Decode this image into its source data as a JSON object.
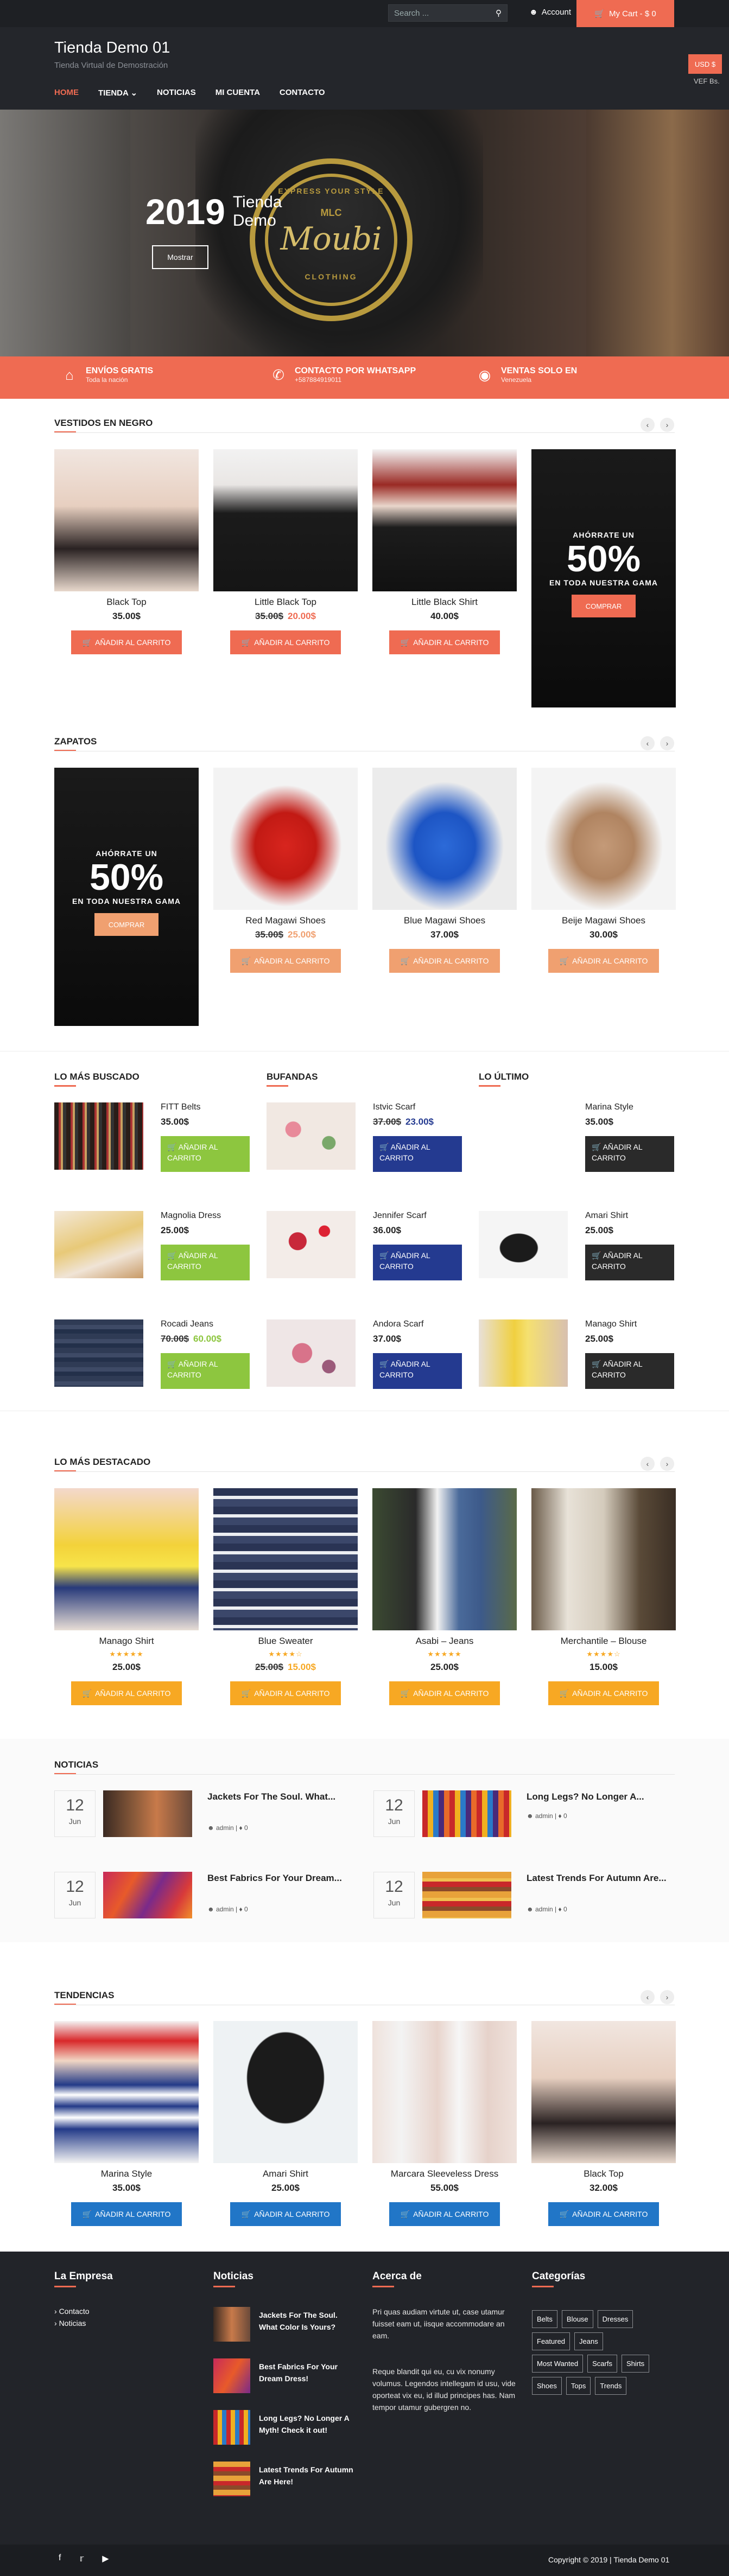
{
  "topbar": {
    "search_placeholder": "Search ...",
    "account": "Account",
    "cart": "My Cart - $ 0"
  },
  "site": {
    "title": "Tienda Demo 01",
    "tagline": "Tienda Virtual de Demostración"
  },
  "currency": {
    "btn": "USD $",
    "alt": "VEF Bs."
  },
  "nav": [
    "HOME",
    "TIENDA",
    "NOTICIAS",
    "MI CUENTA",
    "CONTACTO"
  ],
  "hero": {
    "year": "2019",
    "name_line1": "Tienda",
    "name_line2": "Demo",
    "button": "Mostrar",
    "logo_top": "EXPRESS YOUR STYLE",
    "logo_mid": "MLC",
    "logo_script": "Moubi",
    "logo_bottom": "CLOTHING"
  },
  "features": [
    {
      "icon": "store-icon",
      "title": "ENVÍOS GRATIS",
      "sub": "Toda la nación"
    },
    {
      "icon": "phone-icon",
      "title": "CONTACTO POR WHATSAPP",
      "sub": "+587884919011"
    },
    {
      "icon": "globe-icon",
      "title": "VENTAS SOLO EN",
      "sub": "Venezuela"
    }
  ],
  "vestidos": {
    "title": "VESTIDOS EN NEGRO",
    "products": [
      {
        "name": "Black Top",
        "price": "35.00$",
        "old": "",
        "btn": "AÑADIR AL CARRITO"
      },
      {
        "name": "Little Black Top",
        "price": "20.00$",
        "old": "35.00$",
        "btn": "AÑADIR AL CARRITO"
      },
      {
        "name": "Little Black Shirt",
        "price": "40.00$",
        "old": "",
        "btn": "AÑADIR AL CARRITO"
      }
    ],
    "promo": {
      "sub1": "AHÓRRATE UN",
      "big": "50%",
      "sub2": "EN TODA NUESTRA GAMA",
      "btn": "COMPRAR"
    }
  },
  "zapatos": {
    "title": "ZAPATOS",
    "promo": {
      "sub1": "AHÓRRATE UN",
      "big": "50%",
      "sub2": "EN TODA NUESTRA GAMA",
      "btn": "COMPRAR"
    },
    "products": [
      {
        "name": "Red Magawi Shoes",
        "price": "25.00$",
        "old": "35.00$",
        "btn": "AÑADIR AL CARRITO"
      },
      {
        "name": "Blue Magawi Shoes",
        "price": "37.00$",
        "old": "",
        "btn": "AÑADIR AL CARRITO"
      },
      {
        "name": "Beije Magawi Shoes",
        "price": "30.00$",
        "old": "",
        "btn": "AÑADIR AL CARRITO"
      }
    ]
  },
  "lists": [
    {
      "title": "LO MÁS BUSCADO",
      "items": [
        {
          "name": "FITT Belts",
          "price": "35.00$",
          "old": "",
          "btn": "AÑADIR AL CARRITO"
        },
        {
          "name": "Magnolia Dress",
          "price": "25.00$",
          "old": "",
          "btn": "AÑADIR AL CARRITO"
        },
        {
          "name": "Rocadi Jeans",
          "price": "60.00$",
          "old": "70.00$",
          "btn": "AÑADIR AL CARRITO"
        }
      ]
    },
    {
      "title": "BUFANDAS",
      "items": [
        {
          "name": "Istvic Scarf",
          "price": "23.00$",
          "old": "37.00$",
          "btn": "AÑADIR AL CARRITO"
        },
        {
          "name": "Jennifer Scarf",
          "price": "36.00$",
          "old": "",
          "btn": "AÑADIR AL CARRITO"
        },
        {
          "name": "Andora Scarf",
          "price": "37.00$",
          "old": "",
          "btn": "AÑADIR AL CARRITO"
        }
      ]
    },
    {
      "title": "LO ÚLTIMO",
      "items": [
        {
          "name": "Marina Style",
          "price": "35.00$",
          "old": "",
          "btn": "AÑADIR AL CARRITO"
        },
        {
          "name": "Amari Shirt",
          "price": "25.00$",
          "old": "",
          "btn": "AÑADIR AL CARRITO"
        },
        {
          "name": "Manago Shirt",
          "price": "25.00$",
          "old": "",
          "btn": "AÑADIR AL CARRITO"
        }
      ]
    }
  ],
  "destacado": {
    "title": "LO MÁS DESTACADO",
    "products": [
      {
        "name": "Manago Shirt",
        "price": "25.00$",
        "old": "",
        "btn": "AÑADIR AL CARRITO"
      },
      {
        "name": "Blue Sweater",
        "price": "15.00$",
        "old": "25.00$",
        "btn": "AÑADIR AL CARRITO"
      },
      {
        "name": "Asabi – Jeans",
        "price": "25.00$",
        "old": "",
        "btn": "AÑADIR AL CARRITO"
      },
      {
        "name": "Merchantile – Blouse",
        "price": "15.00$",
        "old": "",
        "btn": "AÑADIR AL CARRITO"
      }
    ]
  },
  "noticias": {
    "title": "NOTICIAS",
    "items": [
      {
        "day": "12",
        "month": "Jun",
        "title": "Jackets For The Soul. What...",
        "author": "admin",
        "comments": "0"
      },
      {
        "day": "12",
        "month": "Jun",
        "title": "Long Legs? No Longer A...",
        "author": "admin",
        "comments": "0"
      },
      {
        "day": "12",
        "month": "Jun",
        "title": "Best Fabrics For Your Dream...",
        "author": "admin",
        "comments": "0"
      },
      {
        "day": "12",
        "month": "Jun",
        "title": "Latest Trends For Autumn Are...",
        "author": "admin",
        "comments": "0"
      }
    ]
  },
  "tendencias": {
    "title": "TENDENCIAS",
    "products": [
      {
        "name": "Marina Style",
        "price": "35.00$",
        "btn": "AÑADIR AL CARRITO"
      },
      {
        "name": "Amari Shirt",
        "price": "25.00$",
        "btn": "AÑADIR AL CARRITO"
      },
      {
        "name": "Marcara Sleeveless Dress",
        "price": "55.00$",
        "btn": "AÑADIR AL CARRITO"
      },
      {
        "name": "Black Top",
        "price": "32.00$",
        "btn": "AÑADIR AL CARRITO"
      }
    ]
  },
  "footer": {
    "empresa": {
      "title": "La Empresa",
      "links": [
        "Contacto",
        "Noticias"
      ]
    },
    "noticias": {
      "title": "Noticias",
      "posts": [
        "Jackets For The Soul. What Color Is Yours?",
        "Best Fabrics For Your Dream Dress!",
        "Long Legs? No Longer A Myth! Check it out!",
        "Latest Trends For Autumn Are Here!"
      ]
    },
    "acerca": {
      "title": "Acerca de",
      "p1": "Pri quas audiam virtute ut, case utamur fuisset eam ut, iisque accommodare an eam.",
      "p2": "Reque blandit qui eu, cu vix nonumy volumus. Legendos intellegam id usu, vide oporteat vix eu, id illud principes has. Nam tempor utamur gubergren no."
    },
    "categorias": {
      "title": "Categorías",
      "tags": [
        "Belts",
        "Blouse",
        "Dresses",
        "Featured",
        "Jeans",
        "Most Wanted",
        "Scarfs",
        "Shirts",
        "Shoes",
        "Tops",
        "Trends"
      ]
    },
    "copyright": "Copyright © 2019 | Tienda Demo 01"
  }
}
